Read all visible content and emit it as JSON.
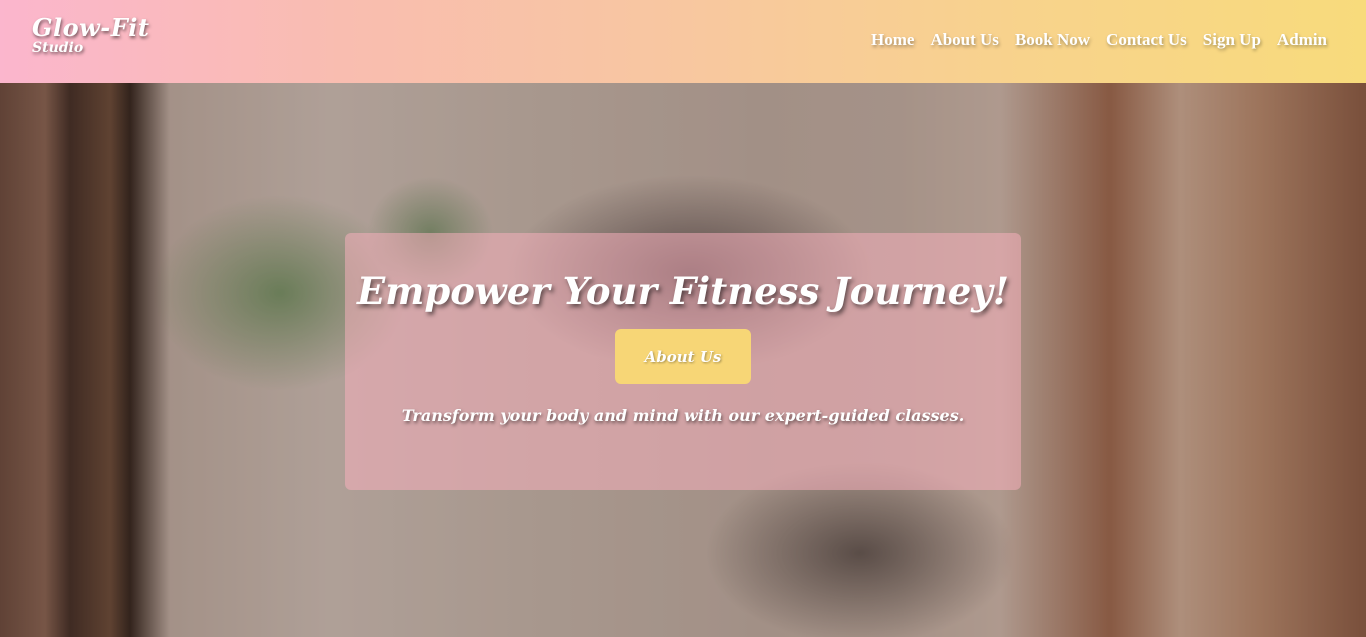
{
  "brand": {
    "name": "Glow-Fit",
    "subtitle": "Studio"
  },
  "nav": {
    "items": [
      "Home",
      "About Us",
      "Book Now",
      "Contact Us",
      "Sign Up",
      "Admin"
    ]
  },
  "hero": {
    "title": "Empower Your Fitness Journey!",
    "button_label": "About Us",
    "tagline": "Transform your body and mind with our expert-guided classes."
  },
  "colors": {
    "header_gradient_start": "#fbb6cd",
    "header_gradient_end": "#f8db7c",
    "overlay": "#fab0be",
    "button": "#f7d676",
    "text": "#ffffff"
  }
}
